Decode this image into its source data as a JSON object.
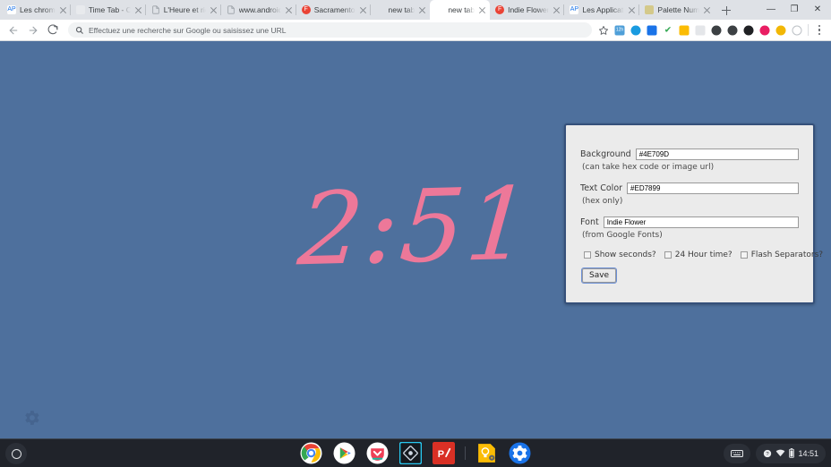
{
  "window": {
    "controls": {
      "minimize": "—",
      "maximize": "❐",
      "close": "✕"
    },
    "new_tab_button": "+"
  },
  "tabs": [
    {
      "title": "Les chrom",
      "favicon": "AP",
      "favicon_color": "#ffffff",
      "favicon_text_color": "#1a73e8",
      "active": false
    },
    {
      "title": "Time Tab - C",
      "favicon": "",
      "favicon_color": "#e8eaed",
      "favicon_text_color": "#ffffff",
      "active": false
    },
    {
      "title": "L'Heure et rie",
      "favicon": "",
      "favicon_color": "#f1f3f4",
      "favicon_text_color": "#80868b",
      "active": false
    },
    {
      "title": "www.android",
      "favicon": "",
      "favicon_color": "#f1f3f4",
      "favicon_text_color": "#80868b",
      "active": false
    },
    {
      "title": "Sacramento",
      "favicon": "F",
      "favicon_color": "#ea4335",
      "favicon_text_color": "#ffffff",
      "active": false
    },
    {
      "title": "new tab",
      "favicon": "",
      "favicon_color": "transparent",
      "favicon_text_color": "#5f6368",
      "active": false
    },
    {
      "title": "new tab",
      "favicon": "",
      "favicon_color": "transparent",
      "favicon_text_color": "#5f6368",
      "active": true
    },
    {
      "title": "Indie Flower",
      "favicon": "F",
      "favicon_color": "#ea4335",
      "favicon_text_color": "#ffffff",
      "active": false
    },
    {
      "title": "Les Applicati",
      "favicon": "AP",
      "favicon_color": "#ffffff",
      "favicon_text_color": "#1a73e8",
      "active": false
    },
    {
      "title": "Palette Num",
      "favicon": "",
      "favicon_color": "#d4c98a",
      "favicon_text_color": "#ffffff",
      "active": false
    }
  ],
  "toolbar": {
    "back_icon": "back-arrow-icon",
    "forward_icon": "forward-arrow-icon",
    "reload_icon": "reload-icon",
    "omnibox": {
      "placeholder": "Effectuez une recherche sur Google ou saisissez une URL",
      "value": "",
      "search_icon": "search-icon"
    },
    "bookmark_icon": "star-icon",
    "menu_icon": "three-dots-menu-icon",
    "extensions": [
      {
        "name": "todoist-extension-icon",
        "color": "#4f9fd8",
        "glyph": "12h"
      },
      {
        "name": "sync-extension-icon",
        "color": "#1a9be0",
        "glyph": ""
      },
      {
        "name": "drive-extension-icon",
        "color": "#1a73e8",
        "glyph": ""
      },
      {
        "name": "grammar-check-extension-icon",
        "color": "#34a853",
        "glyph": "✔"
      },
      {
        "name": "lightbulb-extension-icon",
        "color": "#fbbc04",
        "glyph": ""
      },
      {
        "name": "shield-extension-icon",
        "color": "#e4e6e9",
        "glyph": ""
      },
      {
        "name": "eraser-extension-icon",
        "color": "#3c4043",
        "glyph": ""
      },
      {
        "name": "pocket-extension-icon",
        "color": "#3c4043",
        "glyph": ""
      },
      {
        "name": "camera-extension-icon",
        "color": "#202124",
        "glyph": ""
      },
      {
        "name": "magenta-dot-extension-icon",
        "color": "#e91e63",
        "glyph": ""
      },
      {
        "name": "honey-extension-icon",
        "color": "#f2b705",
        "glyph": ""
      },
      {
        "name": "clock-extension-icon",
        "color": "#bdc1c6",
        "glyph": ""
      }
    ]
  },
  "page": {
    "background_color": "#4E709D",
    "text_color": "#ED7899",
    "clock_time": "2:51",
    "gear_icon": "settings-gear-icon"
  },
  "settings_panel": {
    "background_label": "Background",
    "background_value": "#4E709D",
    "background_hint": "(can take hex code or image url)",
    "text_color_label": "Text Color",
    "text_color_value": "#ED7899",
    "text_color_hint": "(hex only)",
    "font_label": "Font",
    "font_value": "Indie Flower",
    "font_hint": "(from Google Fonts)",
    "checkboxes": [
      {
        "label": "Show seconds?",
        "checked": false
      },
      {
        "label": "24 Hour time?",
        "checked": false
      },
      {
        "label": "Flash Separators?",
        "checked": false
      }
    ],
    "save_label": "Save",
    "border_color": "#35507a"
  },
  "shelf": {
    "launcher_icon": "launcher-circle-icon",
    "apps": [
      {
        "name": "chrome-app-icon",
        "color": "#ffffff",
        "glyph": "",
        "running": true
      },
      {
        "name": "play-store-app-icon",
        "color": "#ffffff",
        "glyph": "",
        "running": false
      },
      {
        "name": "pocket-app-icon",
        "color": "#ffffff",
        "glyph": "",
        "running": true
      },
      {
        "name": "photo-editor-app-icon",
        "color": "#111418",
        "glyph": "",
        "running": false
      },
      {
        "name": "prezi-app-icon",
        "color": "#d93025",
        "glyph": "P/",
        "running": false
      },
      {
        "name": "keep-app-icon",
        "color": "#fbbc04",
        "glyph": "",
        "running": true
      },
      {
        "name": "settings-app-icon",
        "color": "#1a73e8",
        "glyph": "",
        "running": true
      }
    ],
    "tray": {
      "keyboard_icon": "keyboard-icon",
      "help_icon": "help-icon",
      "wifi_icon": "wifi-icon",
      "battery_icon": "battery-icon",
      "time": "14:51"
    }
  }
}
